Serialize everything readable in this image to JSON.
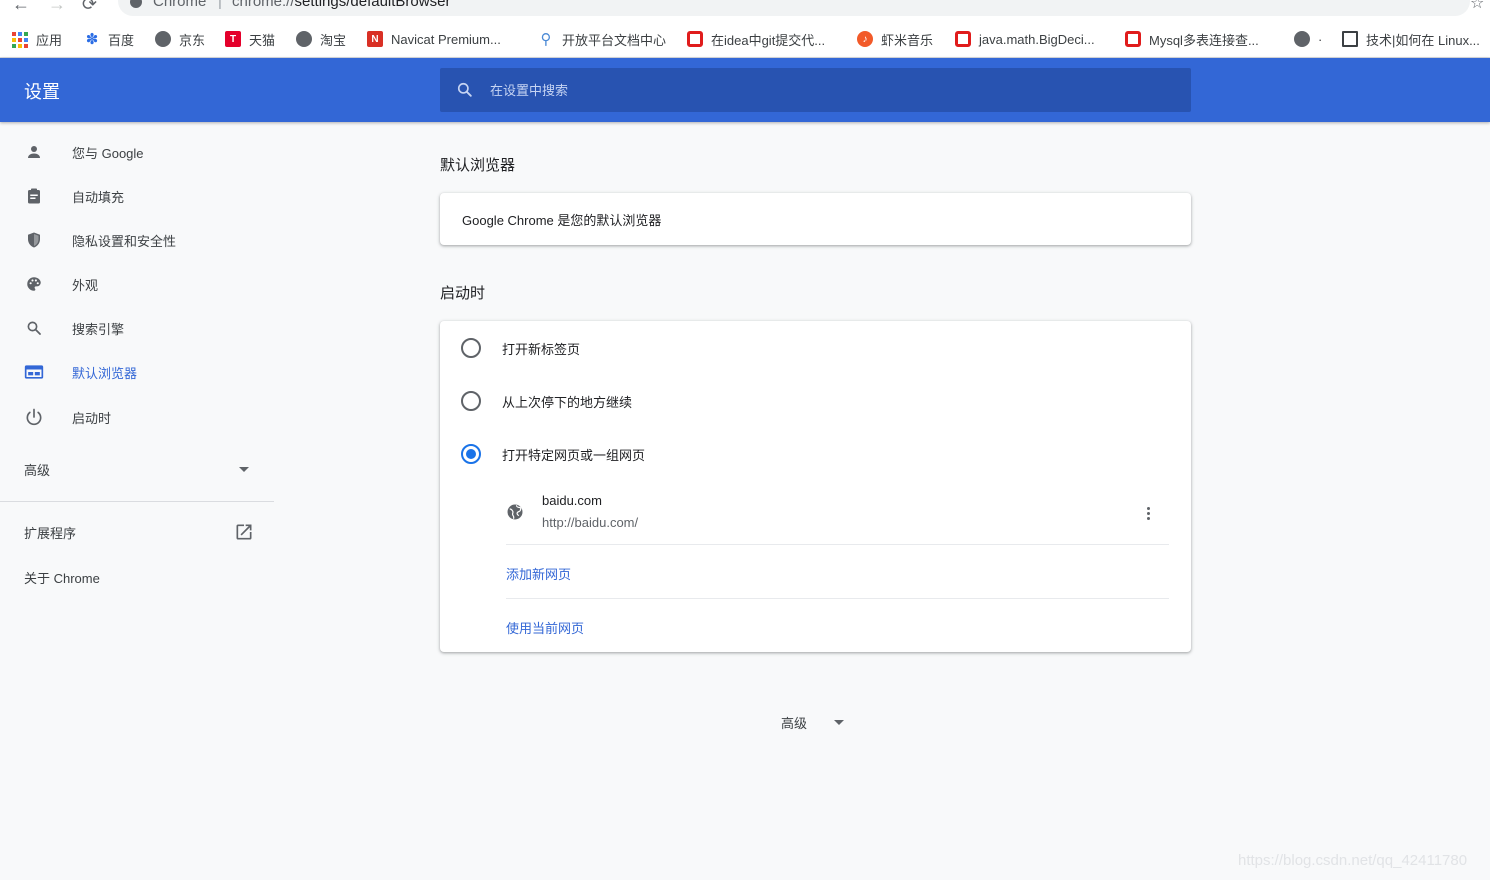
{
  "browser": {
    "tab_hint": "Chrome",
    "url_prefix": "chrome://",
    "url_path": "settings/defaultBrowser",
    "separator": "|"
  },
  "bookmarks": [
    {
      "label": "应用",
      "icon": "apps-grid-icon"
    },
    {
      "label": "百度",
      "icon": "baidu-paw-icon"
    },
    {
      "label": "京东",
      "icon": "globe-icon"
    },
    {
      "label": "天猫",
      "icon": "tmall-icon"
    },
    {
      "label": "淘宝",
      "icon": "globe-icon"
    },
    {
      "label": "Navicat Premium...",
      "icon": "navicat-icon"
    },
    {
      "label": "开放平台文档中心",
      "icon": "open-platform-icon"
    },
    {
      "label": "在idea中git提交代...",
      "icon": "csdn-icon"
    },
    {
      "label": "虾米音乐",
      "icon": "xiami-icon"
    },
    {
      "label": "java.math.BigDeci...",
      "icon": "csdn-icon"
    },
    {
      "label": "Mysql多表连接查...",
      "icon": "csdn-icon"
    },
    {
      "label": "·",
      "icon": "globe-icon"
    },
    {
      "label": "技术|如何在 Linux...",
      "icon": "document-icon"
    }
  ],
  "header": {
    "title": "设置",
    "search_placeholder": "在设置中搜索"
  },
  "sidebar": {
    "items": [
      {
        "label": "您与 Google",
        "icon": "person-icon"
      },
      {
        "label": "自动填充",
        "icon": "clipboard-icon"
      },
      {
        "label": "隐私设置和安全性",
        "icon": "shield-icon"
      },
      {
        "label": "外观",
        "icon": "palette-icon"
      },
      {
        "label": "搜索引擎",
        "icon": "search-icon"
      },
      {
        "label": "默认浏览器",
        "icon": "browser-window-icon",
        "active": true
      },
      {
        "label": "启动时",
        "icon": "power-icon"
      }
    ],
    "advanced": "高级",
    "extensions": "扩展程序",
    "about": "关于 Chrome"
  },
  "main": {
    "default_browser": {
      "title": "默认浏览器",
      "status": "Google Chrome 是您的默认浏览器"
    },
    "on_startup": {
      "title": "启动时",
      "options": [
        {
          "label": "打开新标签页",
          "checked": false
        },
        {
          "label": "从上次停下的地方继续",
          "checked": false
        },
        {
          "label": "打开特定网页或一组网页",
          "checked": true
        }
      ],
      "pages": [
        {
          "title": "baidu.com",
          "url": "http://baidu.com/"
        }
      ],
      "add_page": "添加新网页",
      "use_current": "使用当前网页"
    },
    "advanced_toggle": "高级"
  },
  "watermark": "https://blog.csdn.net/qq_42411780",
  "colors": {
    "accent": "#3367d6",
    "header_bg": "#3367d6",
    "search_bg": "#2853b1",
    "radio_checked": "#1a73e8",
    "page_bg": "#f8f9fa"
  }
}
